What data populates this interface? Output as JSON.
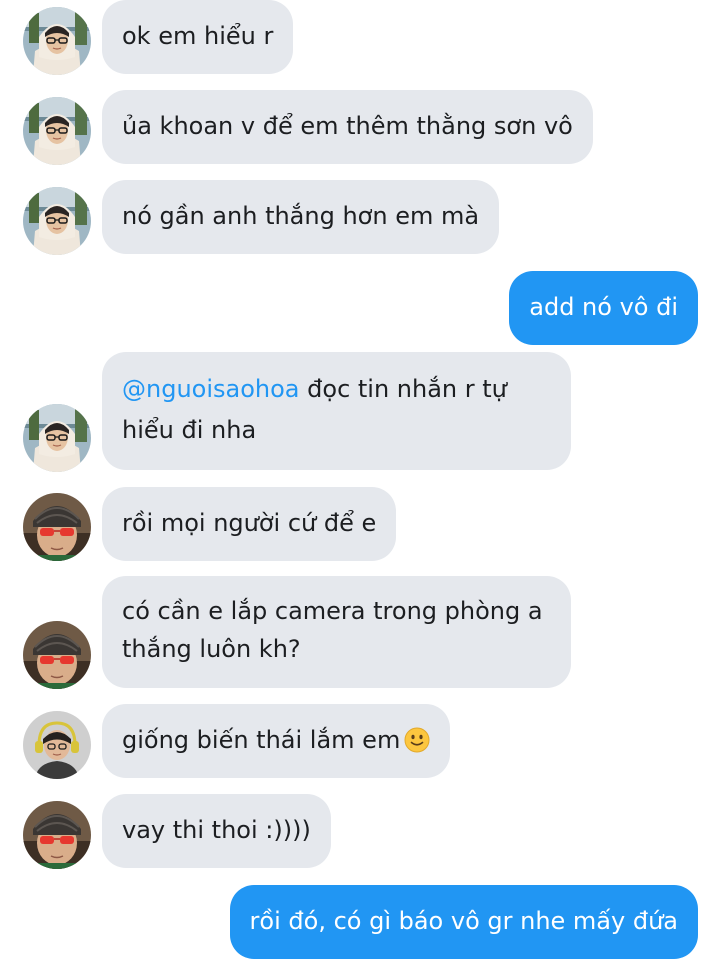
{
  "messages": [
    {
      "text": "ok em hiểu r"
    },
    {
      "text": "ủa khoan v để em thêm thằng sơn vô"
    },
    {
      "text": "nó gần anh thắng hơn em mà"
    },
    {
      "text": "add nó vô đi"
    },
    {
      "mention": "@nguoisaohoa",
      "text_line1": " đọc tin nhắn r tự",
      "text_line2": "hiểu đi nha"
    },
    {
      "text": "rồi mọi người cứ để e"
    },
    {
      "text_line1": "có cần e lắp camera trong phòng a",
      "text_line2": "thắng luôn kh?"
    },
    {
      "text": "giống biến thái lắm em",
      "emoji": "slightly-smiling-face"
    },
    {
      "text": "vay thi thoi :))))"
    },
    {
      "text": "rồi đó, có gì báo vô gr nhe mấy đứa"
    }
  ],
  "colors": {
    "incoming_bubble": "#e5e8ed",
    "outgoing_bubble": "#2196f3",
    "mention": "#2196f3"
  }
}
